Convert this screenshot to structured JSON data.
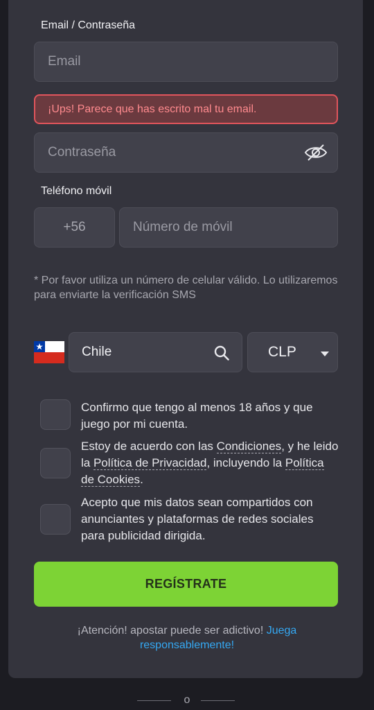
{
  "form": {
    "credentials_label": "Email / Contraseña",
    "email_placeholder": "Email",
    "email_error": "¡Ups! Parece que has escrito mal tu email.",
    "password_placeholder": "Contraseña",
    "phone_label": "Teléfono móvil",
    "phone_prefix": "+56",
    "phone_placeholder": "Número de móvil",
    "phone_hint": "* Por favor utiliza un número de celular válido. Lo utilizaremos para enviarte la verificación SMS",
    "country": "Chile",
    "currency": "CLP",
    "checkboxes": [
      {
        "text": "Confirmo que tengo al menos 18 años y que juego por mi cuenta.",
        "checked": false
      },
      {
        "text_before": "Estoy de acuerdo con las ",
        "link1": "Condiciones",
        "text_mid1": ", y he leido la ",
        "link2": "Política de Privacidad",
        "text_mid2": ", incluyendo la ",
        "link3": "Política de Cookies",
        "text_after": ".",
        "checked": false
      },
      {
        "text": "Acepto que mis datos sean compartidos con anunciantes y plataformas de redes sociales para publicidad dirigida.",
        "checked": false
      }
    ],
    "register_label": "REGÍSTRATE",
    "warning_text": "¡Atención! apostar puede ser adictivo! ",
    "warning_link": "Juega responsablemente!"
  },
  "divider": {
    "label": "o"
  },
  "colors": {
    "background": "#1c1c22",
    "card": "#34343d",
    "input": "#41414b",
    "error_border": "#e2555c",
    "error_text": "#ff8a8e",
    "accent_green": "#7dd335",
    "link_blue": "#34a8f2"
  },
  "icons": {
    "password_toggle": "eye-off-icon",
    "country_search": "search-icon",
    "currency_dropdown": "caret-down-icon",
    "country_flag": "chile-flag-icon"
  }
}
